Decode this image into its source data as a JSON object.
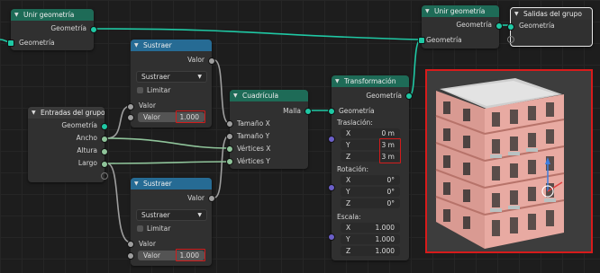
{
  "nodes": {
    "unir1": {
      "title": "Unir geometría",
      "out_geometry": "Geometría",
      "in_geometry": "Geometría"
    },
    "sustraer1": {
      "title": "Sustraer",
      "out_value": "Valor",
      "operation": "Sustraer",
      "clamp": "Limitar",
      "in_value": "Valor",
      "field_label": "Valor",
      "field_value": "1.000"
    },
    "entradas": {
      "title": "Entradas del grupo",
      "out": [
        "Geometría",
        "Ancho",
        "Altura",
        "Largo"
      ]
    },
    "cuadricula": {
      "title": "Cuadrícula",
      "out_mesh": "Malla",
      "in": [
        "Tamaño X",
        "Tamaño Y",
        "Vértices X",
        "Vértices Y"
      ]
    },
    "sustraer2": {
      "title": "Sustraer",
      "out_value": "Valor",
      "operation": "Sustraer",
      "clamp": "Limitar",
      "in_value": "Valor",
      "field_label": "Valor",
      "field_value": "1.000"
    },
    "transform": {
      "title": "Transformación",
      "out_geometry": "Geometría",
      "in_geometry": "Geometría",
      "translation_label": "Traslación:",
      "translation": [
        {
          "axis": "X",
          "value": "0 m"
        },
        {
          "axis": "Y",
          "value": "3 m"
        },
        {
          "axis": "Z",
          "value": "3 m"
        }
      ],
      "rotation_label": "Rotación:",
      "rotation": [
        {
          "axis": "X",
          "value": "0°"
        },
        {
          "axis": "Y",
          "value": "0°"
        },
        {
          "axis": "Z",
          "value": "0°"
        }
      ],
      "scale_label": "Escala:",
      "scale": [
        {
          "axis": "X",
          "value": "1.000"
        },
        {
          "axis": "Y",
          "value": "1.000"
        },
        {
          "axis": "Z",
          "value": "1.000"
        }
      ]
    },
    "unir2": {
      "title": "Unir geometría",
      "out_geometry": "Geometría",
      "in_geometry": "Geometría"
    },
    "salidas": {
      "title": "Salidas del grupo",
      "in_geometry": "Geometría"
    }
  },
  "colors": {
    "geometry_socket": "#1fc8a4",
    "number_socket": "#9e9e9e",
    "vector_socket": "#6b5fc7",
    "highlight": "#d11b1b",
    "geometry_header": "#1e6b57",
    "math_header": "#266b94"
  }
}
